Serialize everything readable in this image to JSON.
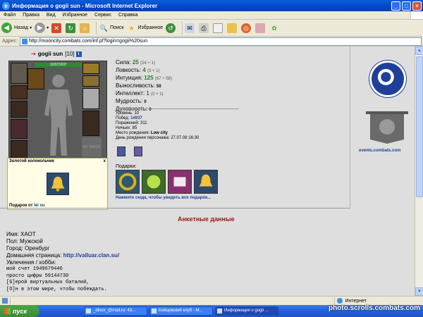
{
  "window": {
    "title": "Информация о gogii sun - Microsoft Internet Explorer"
  },
  "menu": [
    "Файл",
    "Правка",
    "Вид",
    "Избранное",
    "Сервис",
    "Справка"
  ],
  "toolbar": {
    "back": "Назад",
    "search": "Поиск",
    "favorites": "Избранное"
  },
  "address": {
    "label": "Адрес:",
    "url": "http://mooncity.combats.com/inf.pl?login=gogii%20sun"
  },
  "character": {
    "name": "gogii sun",
    "level": "[10]",
    "hp": "1637/1637",
    "no_image": "NO IMAGE"
  },
  "tooltip": {
    "title": "Золотой колокольчик",
    "close": "x",
    "gift_from_label": "Подарок от",
    "gift_from": "lei su"
  },
  "stats": [
    {
      "label": "Сила:",
      "value": "25",
      "bonus": "(24 + 1)"
    },
    {
      "label": "Ловкость:",
      "value": "4",
      "bonus": "(3 + 1)"
    },
    {
      "label": "Интуиция:",
      "value": "125",
      "bonus": "(67 + 58)"
    },
    {
      "label": "Выносливость:",
      "value": "50",
      "bonus": ""
    },
    {
      "label": "Интеллект:",
      "value": "1",
      "bonus": "(0 + 1)"
    },
    {
      "label": "Мудрость:",
      "value": "0",
      "bonus": ""
    },
    {
      "label": "Духовность:",
      "value": "0",
      "bonus": ""
    }
  ],
  "info": {
    "level_label": "Уровень:",
    "level": "10",
    "wins_label": "Побед:",
    "wins": "14937",
    "losses_label": "Поражений:",
    "losses": "311",
    "draws_label": "Ничьих:",
    "draws": "85",
    "birthplace_label": "Место рождения:",
    "birthplace": "Low city",
    "birthday_label": "День рождения персонажа:",
    "birthday": "27.07.08 16:30"
  },
  "gifts": {
    "label": "Подарки:",
    "link": "Нажмите сюда, чтобы увидеть все подарки..."
  },
  "events": "events.combats.com",
  "anketa": {
    "title": "Анкетные данные",
    "name_line": "Имя: ХАОТ",
    "sex_line": "Пол: Мужской",
    "city_line": "Город: Оренбург",
    "homepage_label": "Домашняя страница:",
    "homepage": "http://valluar.clan.su/",
    "hobby_label": "Увлечения / хобби:",
    "text": "мой счет 1949679446\nпросто цифры 59144730\n[G]ерой виртуальных баталий,\n[O]н в этом мире, чтобы побеждать."
  },
  "status": {
    "zone": "Интернет"
  },
  "taskbar": {
    "start": "пуск",
    "tasks": [
      "_dlixor_@mail.ru: 43...",
      "Бойцовский клуб - M...",
      "Информация о gogii ..."
    ]
  },
  "watermark": "photo.scrolls.combats.com",
  "colors": {
    "stat_value": "#2a7a2a",
    "link": "#1e3f96",
    "heading": "#a01818"
  }
}
